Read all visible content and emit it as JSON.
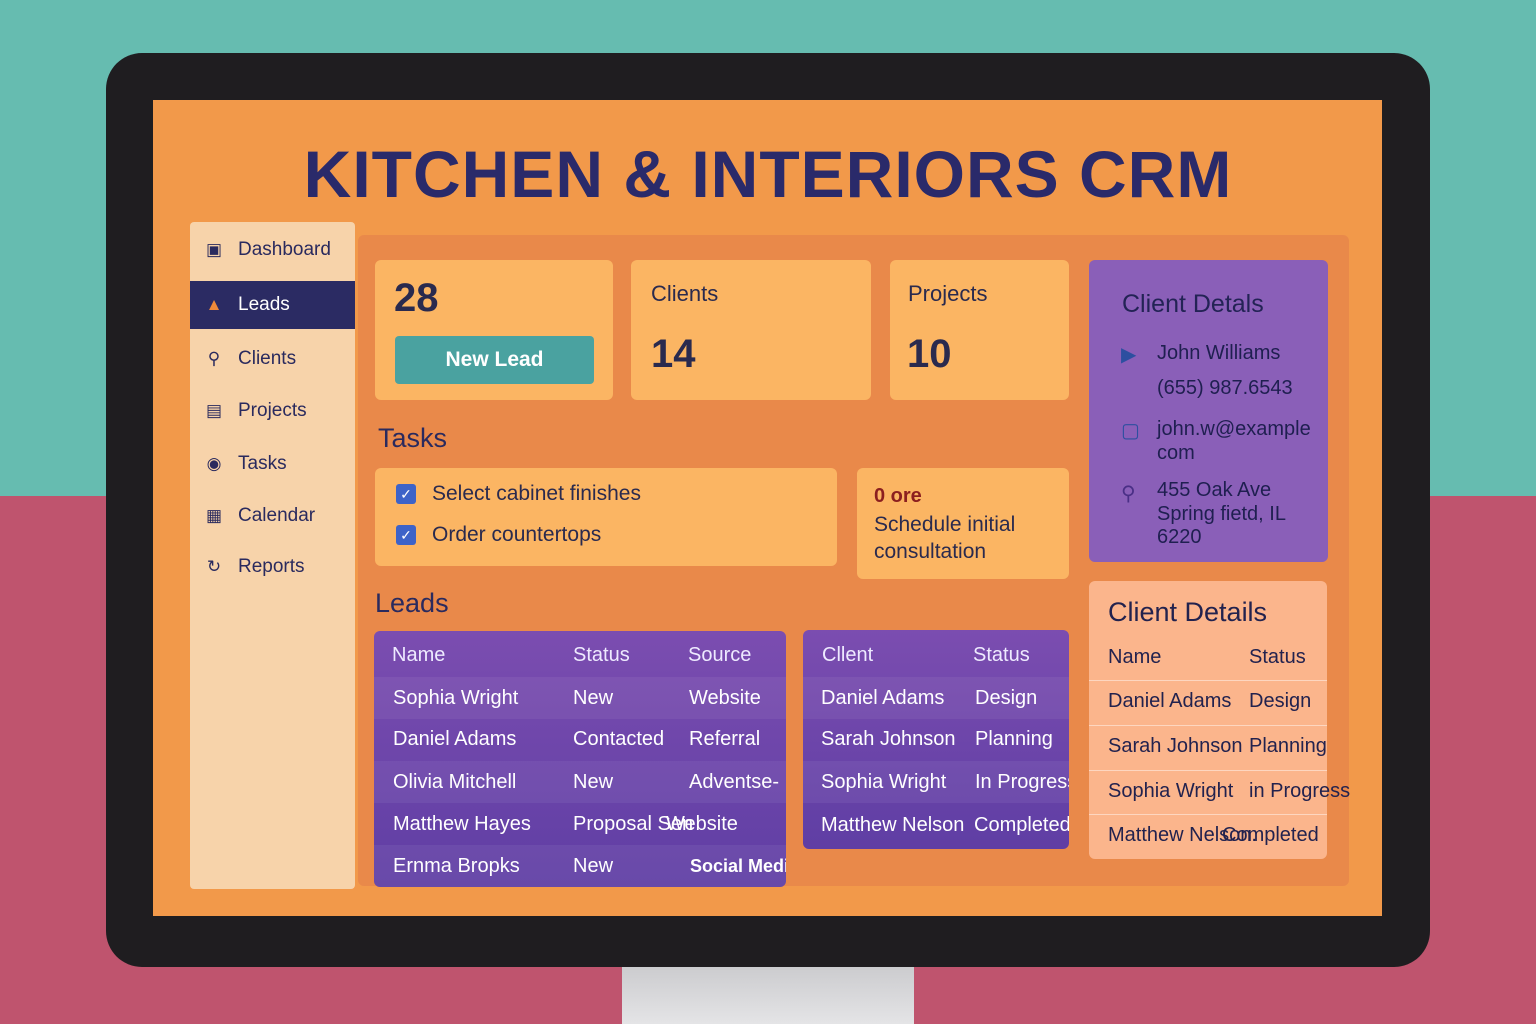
{
  "app_title": "KITCHEN & INTERIORS CRM",
  "sidebar": {
    "items": [
      {
        "label": "Dashboard",
        "icon": "dashboard-icon",
        "active": false
      },
      {
        "label": "Leads",
        "icon": "lock-icon",
        "active": true
      },
      {
        "label": "Clients",
        "icon": "person-pin-icon",
        "active": false
      },
      {
        "label": "Projects",
        "icon": "folder-icon",
        "active": false
      },
      {
        "label": "Tasks",
        "icon": "target-icon",
        "active": false
      },
      {
        "label": "Calendar",
        "icon": "calendar-icon",
        "active": false
      },
      {
        "label": "Reports",
        "icon": "refresh-icon",
        "active": false
      }
    ]
  },
  "stats": {
    "leads_count": "28",
    "new_lead_button": "New Lead",
    "clients_label": "Clients",
    "clients_count": "14",
    "projects_label": "Projects",
    "projects_count": "10"
  },
  "tasks": {
    "title": "Tasks",
    "items": [
      {
        "label": "Select cabinet finishes",
        "checked": true
      },
      {
        "label": "Order countertops",
        "checked": true
      }
    ],
    "side_card": {
      "badge": "0 ore",
      "text_line1": "Schedule initial",
      "text_line2": "consultation"
    }
  },
  "leads": {
    "title": "Leads",
    "columns": [
      "Name",
      "Status",
      "Source"
    ],
    "rows": [
      [
        "Sophia Wright",
        "New",
        "Website"
      ],
      [
        "Daniel Adams",
        "Contacted",
        "Referral"
      ],
      [
        "Olivia Mitchell",
        "New",
        "Adventse-"
      ],
      [
        "Matthew Hayes",
        "Proposal Sen",
        "Website"
      ],
      [
        "Ernma Bropks",
        "New",
        "Social Media"
      ]
    ]
  },
  "clients_table": {
    "columns": [
      "Cllent",
      "Status"
    ],
    "rows": [
      [
        "Daniel Adams",
        "Design"
      ],
      [
        "Sarah Johnson",
        "Planning"
      ],
      [
        "Sophia Wright",
        "In Progress"
      ],
      [
        "Matthew Nelson",
        "Completed"
      ]
    ]
  },
  "client_detail_card": {
    "title": "Client Detals",
    "name": "John Williams",
    "phone": "(655) 987.6543",
    "email_line1": "john.w@example",
    "email_line2": "com",
    "address_line1": "455 Oak Ave",
    "address_line2": "Spring fietd, IL 6220"
  },
  "client_details_table": {
    "title": "Client Details",
    "columns": [
      "Name",
      "Status"
    ],
    "rows": [
      [
        "Daniel Adams",
        "Design"
      ],
      [
        "Sarah Johnson",
        "Planning"
      ],
      [
        "Sophia Wright",
        "in Progress"
      ],
      [
        "Matthew Nelson.",
        "Completed"
      ]
    ]
  },
  "colors": {
    "screen_bg": "#f2994a",
    "accent_navy": "#2b2b63",
    "button_teal": "#4aa2a0",
    "table_purple": "#6a44a8",
    "card_orange": "#fbb563"
  }
}
